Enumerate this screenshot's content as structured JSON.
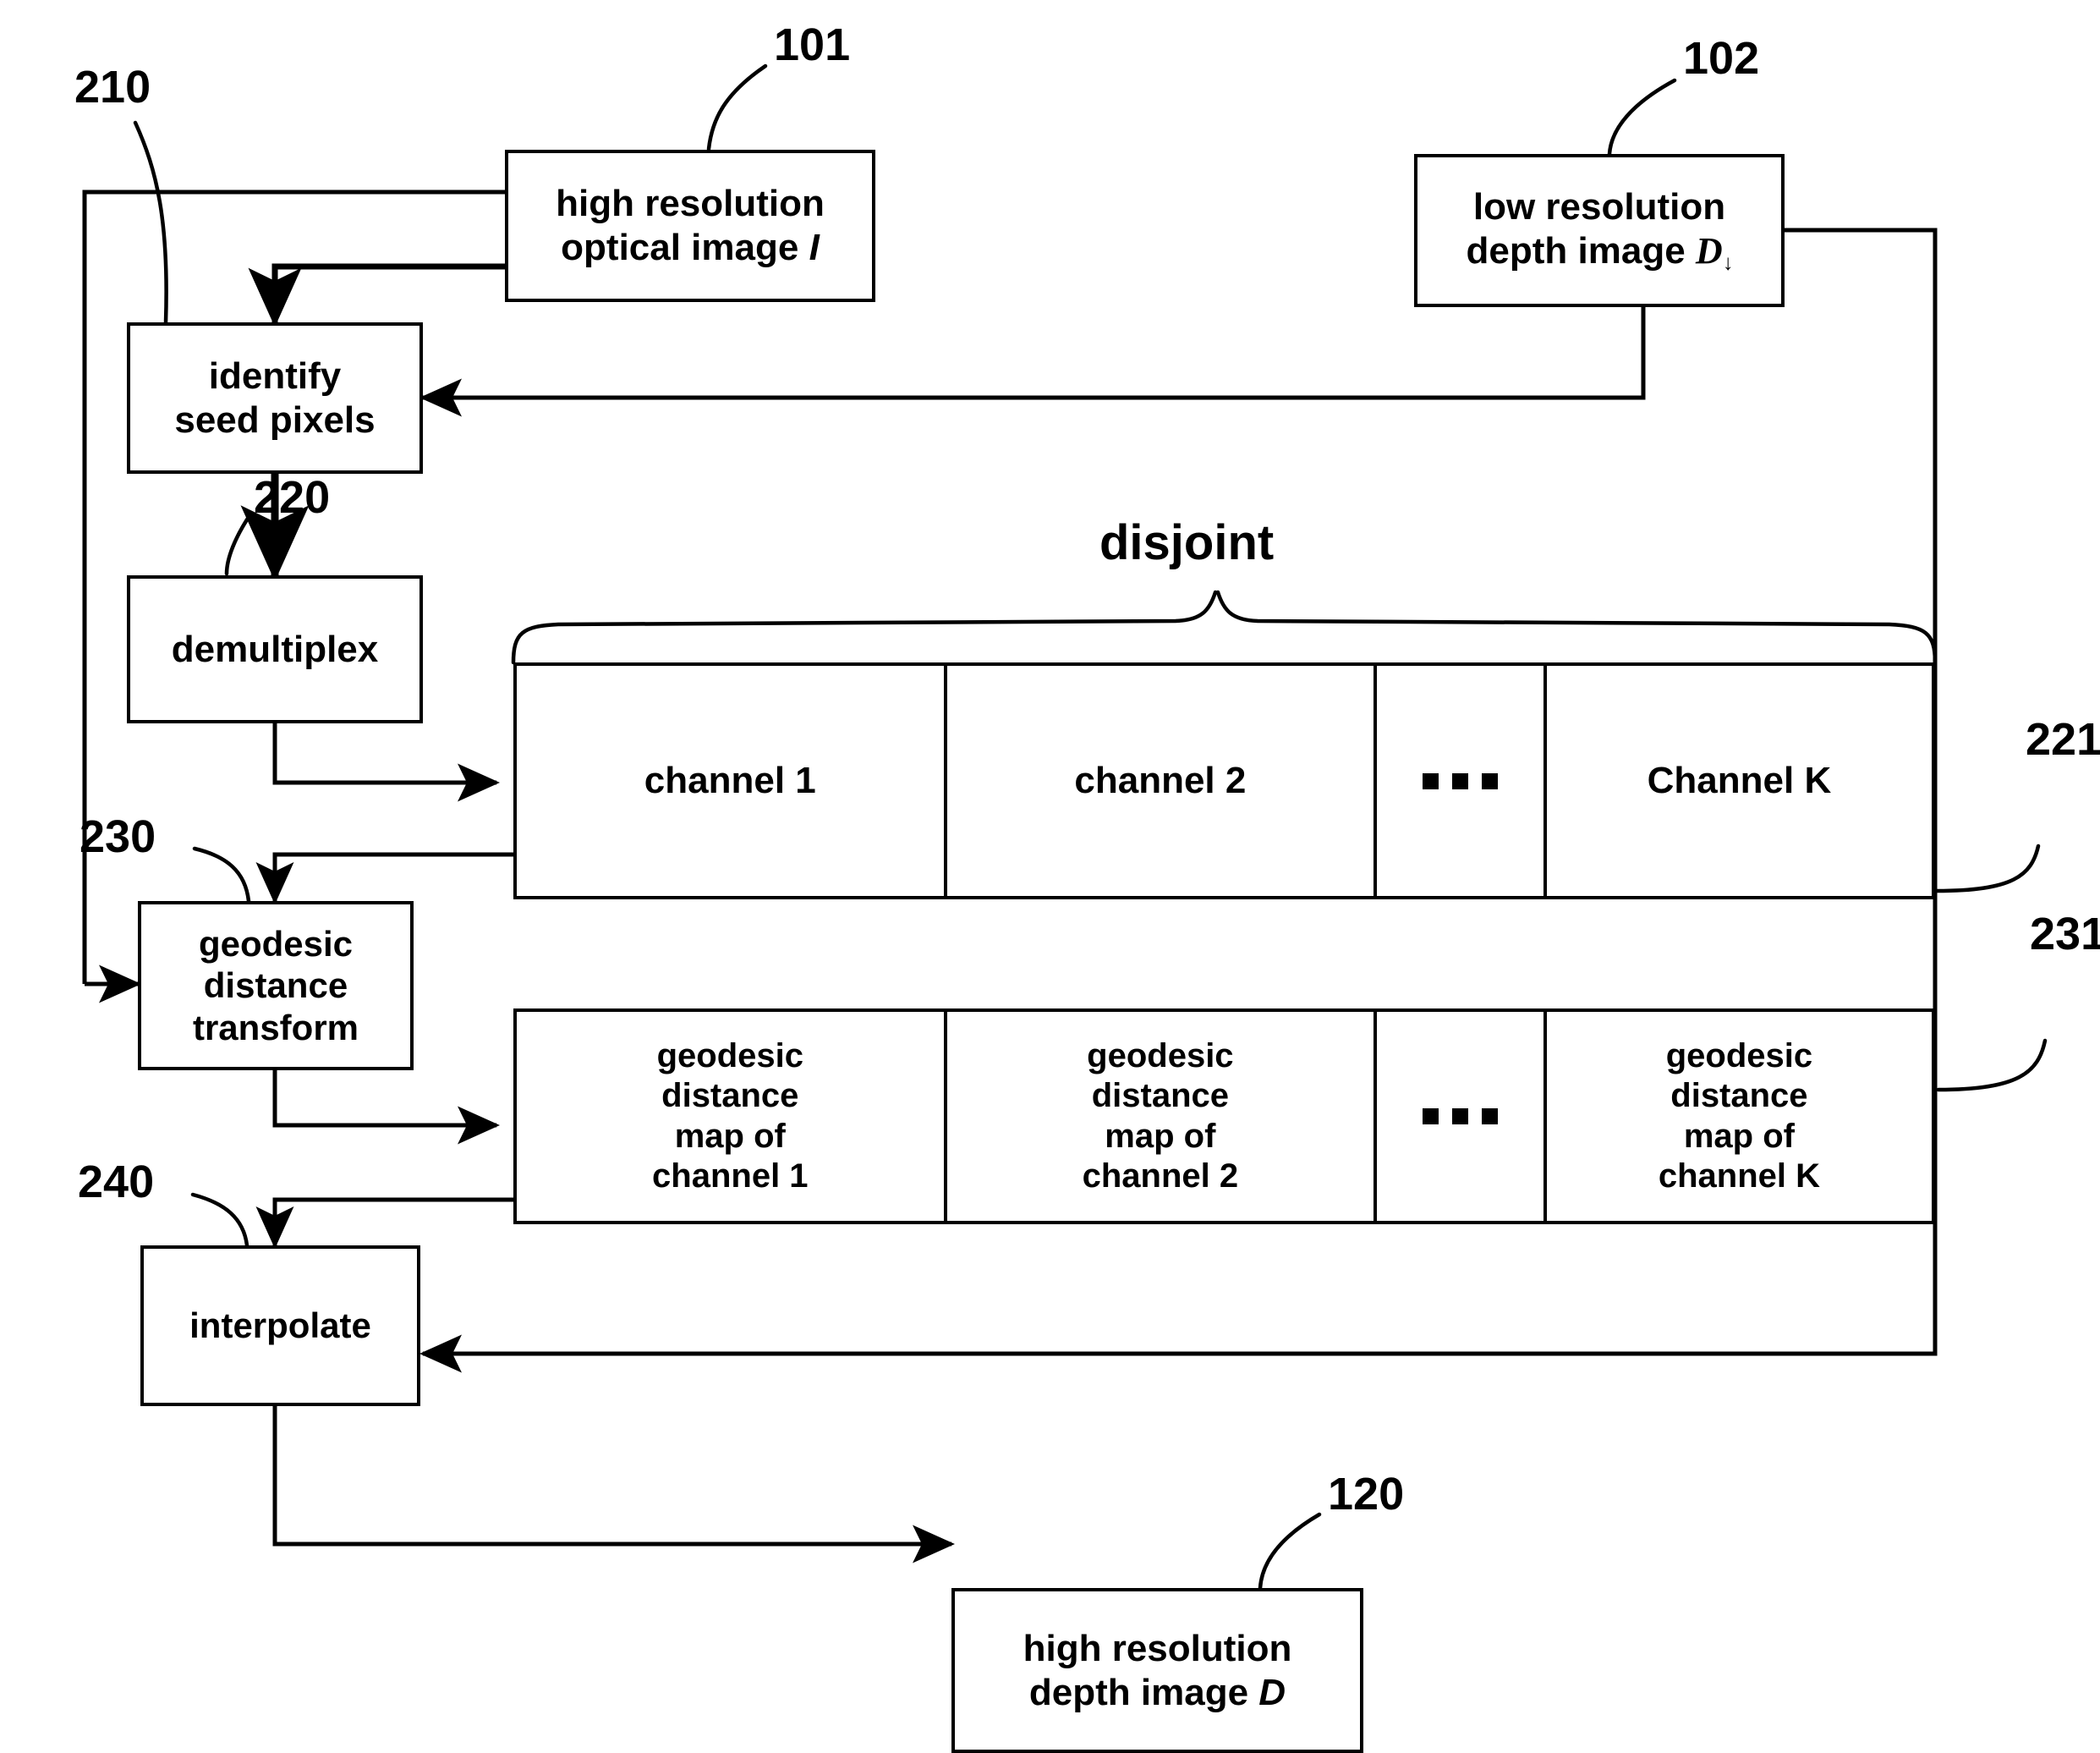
{
  "figure": {
    "type": "patent-flow-diagram",
    "background_color": "#ffffff",
    "line_color": "#000000"
  },
  "nodes": {
    "optical_image": {
      "ref": "101",
      "line1": "high resolution",
      "line2_pre": "optical image ",
      "line2_sym": "I"
    },
    "depth_image_low": {
      "ref": "102",
      "line1": "low resolution",
      "line2_pre": "depth image ",
      "line2_sym": "D",
      "line2_sub": "↓"
    },
    "identify_seed": {
      "ref": "210",
      "line1": "identify",
      "line2": "seed pixels"
    },
    "demultiplex": {
      "ref": "220",
      "line1": "demultiplex"
    },
    "geodesic_transform": {
      "ref": "230",
      "line1": "geodesic",
      "line2": "distance",
      "line3": "transform"
    },
    "interpolate": {
      "ref": "240",
      "line1": "interpolate"
    },
    "depth_image_high": {
      "ref": "120",
      "line1": "high resolution",
      "line2_pre": "depth image ",
      "line2_sym": "D"
    }
  },
  "channel_row": {
    "ref": "221",
    "brace_label": "disjoint",
    "cells": [
      {
        "kind": "text",
        "label": "channel 1"
      },
      {
        "kind": "text",
        "label": "channel 2"
      },
      {
        "kind": "ellipsis",
        "label": "▪ ▪ ▪"
      },
      {
        "kind": "text",
        "label": "Channel K"
      }
    ]
  },
  "geodesic_map_row": {
    "ref": "231",
    "cells": [
      {
        "kind": "text",
        "l1": "geodesic",
        "l2": "distance",
        "l3": "map of",
        "l4": "channel 1"
      },
      {
        "kind": "text",
        "l1": "geodesic",
        "l2": "distance",
        "l3": "map of",
        "l4": "channel 2"
      },
      {
        "kind": "ellipsis",
        "label": "▪ ▪ ▪"
      },
      {
        "kind": "text",
        "l1": "geodesic",
        "l2": "distance",
        "l3": "map of",
        "l4": "channel K"
      }
    ]
  }
}
